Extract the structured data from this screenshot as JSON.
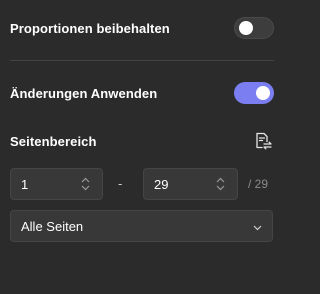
{
  "settings": {
    "keep_proportions": {
      "label": "Proportionen beibehalten",
      "enabled": false
    },
    "apply_changes": {
      "label": "Änderungen Anwenden",
      "enabled": true
    }
  },
  "page_range": {
    "label": "Seitenbereich",
    "swap_icon": "swap-pages-icon",
    "from": "1",
    "to": "29",
    "separator": "-",
    "total": "/ 29"
  },
  "pages_select": {
    "selected": "Alle Seiten"
  },
  "colors": {
    "background": "#2b2b2b",
    "accent": "#7b7ef0",
    "field_bg": "#383838"
  }
}
